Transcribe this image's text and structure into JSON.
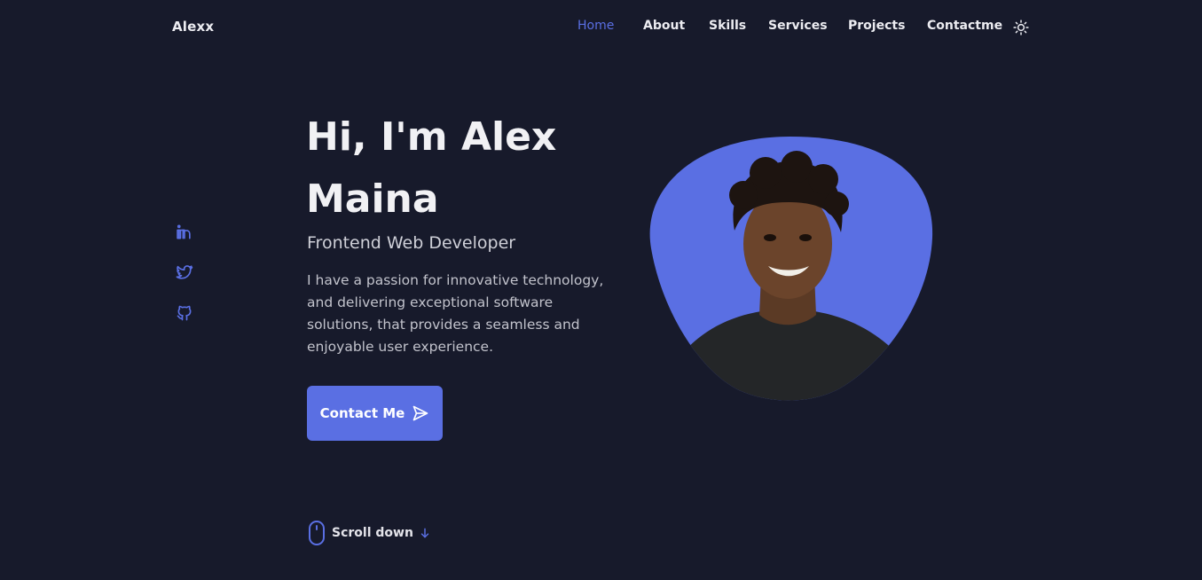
{
  "header": {
    "logo": "Alexx",
    "nav": [
      {
        "label": "Home",
        "active": true
      },
      {
        "label": "About"
      },
      {
        "label": "Skills"
      },
      {
        "label": "Services"
      },
      {
        "label": "Projects"
      },
      {
        "label": "Contactme"
      }
    ],
    "theme_icon": "sun-icon"
  },
  "socials": [
    {
      "icon": "linkedin-icon"
    },
    {
      "icon": "twitter-icon"
    },
    {
      "icon": "github-icon"
    }
  ],
  "hero": {
    "title": "Hi, I'm Alex Maina",
    "subtitle": "Frontend Web Developer",
    "description": "I have a passion for innovative technology, and delivering exceptional software solutions, that provides a seamless and enjoyable user experience.",
    "cta_label": "Contact Me",
    "cta_icon": "send-icon"
  },
  "scroll": {
    "label": "Scroll down",
    "mouse_icon": "mouse-icon",
    "arrow_icon": "arrow-down-icon"
  },
  "colors": {
    "background": "#171a2b",
    "accent": "#5a6fe3",
    "text": "#ececf1"
  }
}
